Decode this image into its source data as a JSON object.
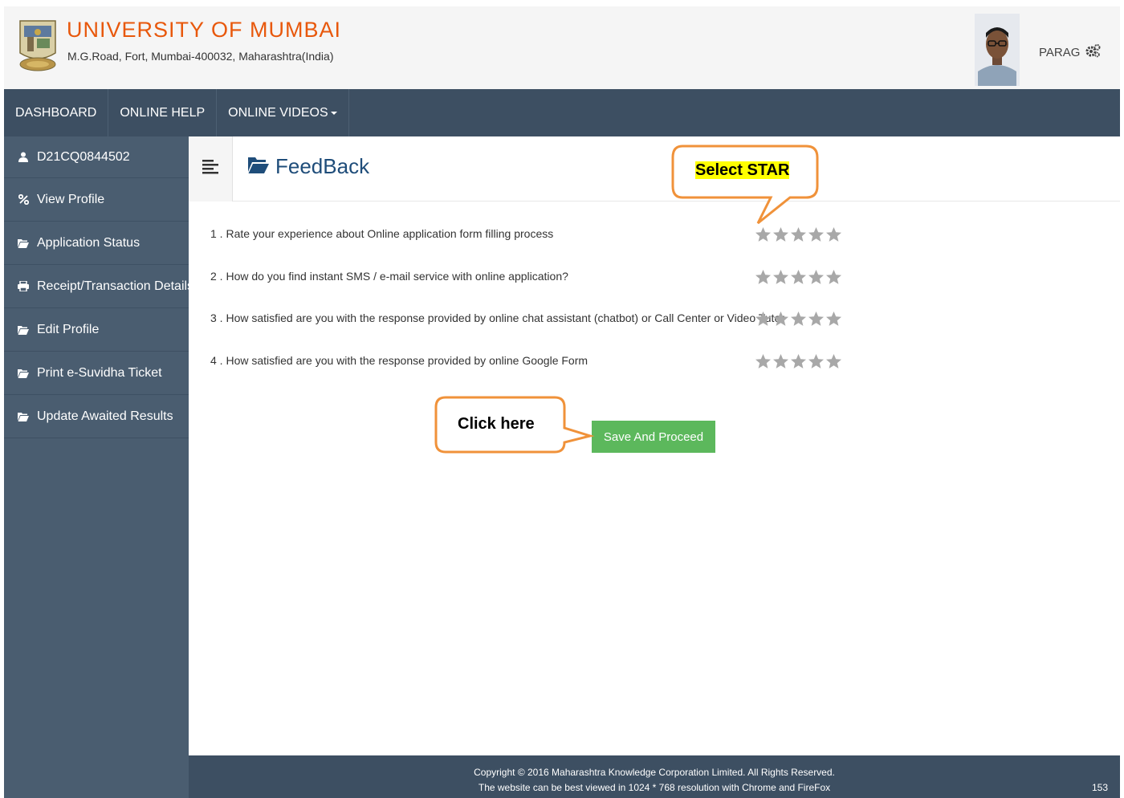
{
  "header": {
    "title": "UNIVERSITY OF MUMBAI",
    "address": "M.G.Road, Fort, Mumbai-400032, Maharashtra(India)",
    "user_name": "PARAG",
    "logo_icon": "university-crest-icon",
    "settings_icon": "gears-icon"
  },
  "navbar": {
    "items": [
      {
        "label": "DASHBOARD"
      },
      {
        "label": "ONLINE HELP"
      },
      {
        "label": "ONLINE VIDEOS"
      }
    ]
  },
  "sidebar": {
    "items": [
      {
        "label": "D21CQ0844502",
        "icon": "user-icon"
      },
      {
        "label": "View Profile",
        "icon": "percent-icon"
      },
      {
        "label": "Application Status",
        "icon": "folder-open-icon"
      },
      {
        "label": "Receipt/Transaction Details",
        "icon": "print-icon"
      },
      {
        "label": "Edit Profile",
        "icon": "folder-open-icon"
      },
      {
        "label": "Print e-Suvidha Ticket",
        "icon": "folder-open-icon"
      },
      {
        "label": "Update Awaited Results",
        "icon": "folder-open-icon"
      }
    ]
  },
  "main": {
    "title": "FeedBack",
    "questions": [
      {
        "text": "1 . Rate your experience about Online application form filling process",
        "rating": 0,
        "max": 5
      },
      {
        "text": "2 . How do you find instant SMS / e-mail service with online application?",
        "rating": 0,
        "max": 5
      },
      {
        "text": "3 . How satisfied are you with the response provided by online chat assistant (chatbot) or Call Center or Video Tutor",
        "rating": 0,
        "max": 5
      },
      {
        "text": "4 . How satisfied are you with the response provided by online Google Form",
        "rating": 0,
        "max": 5
      }
    ],
    "save_label": "Save And Proceed"
  },
  "annotations": {
    "select_star": "Select STAR",
    "click_here": "Click here"
  },
  "footer": {
    "line1": "Copyright © 2016 Maharashtra Knowledge Corporation Limited. All Rights Reserved.",
    "line2": "The website can be best viewed in 1024 * 768 resolution with Chrome and FireFox",
    "page_num": "153"
  },
  "colors": {
    "brand_orange": "#e8580c",
    "nav_bg": "#3d4f62",
    "sidebar_bg": "#4a5d70",
    "button_green": "#5cb85c",
    "star_gray": "#a8a8a8",
    "callout_border": "#f0923a",
    "highlight": "#ffff00"
  }
}
